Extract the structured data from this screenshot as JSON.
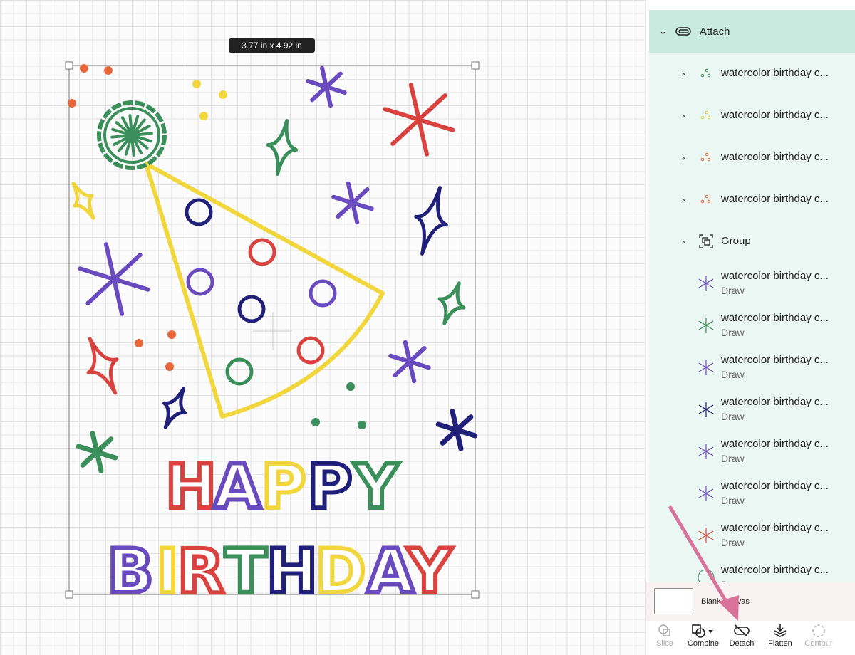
{
  "canvas": {
    "dimensions": "3.77  in x 4.92  in",
    "happy": [
      "H",
      "A",
      "P",
      "P",
      "Y"
    ],
    "birthday": [
      "B",
      "I",
      "R",
      "T",
      "H",
      "D",
      "A",
      "Y"
    ],
    "colors": {
      "red": "#d9423e",
      "purple": "#6a4bbf",
      "yellow": "#f2d73c",
      "navy": "#20207a",
      "green": "#3a8f5a",
      "orange": "#e8663a"
    }
  },
  "layers": {
    "attach_label": "Attach",
    "groups": [
      {
        "label": "watercolor birthday c...",
        "icon": "dots-icon",
        "color": "#3a8f5a"
      },
      {
        "label": "watercolor birthday c...",
        "icon": "dots-icon",
        "color": "#e0d24a"
      },
      {
        "label": "watercolor birthday c...",
        "icon": "dots-icon",
        "color": "#e8663a"
      },
      {
        "label": "watercolor birthday c...",
        "icon": "dots-icon",
        "color": "#e8663a"
      },
      {
        "label": "Group",
        "icon": "group-icon",
        "color": "#333"
      }
    ],
    "draws": [
      {
        "label": "watercolor birthday c...",
        "sub": "Draw",
        "icon": "star-icon",
        "color": "#6a4bbf"
      },
      {
        "label": "watercolor birthday c...",
        "sub": "Draw",
        "icon": "star-icon",
        "color": "#3a8f5a"
      },
      {
        "label": "watercolor birthday c...",
        "sub": "Draw",
        "icon": "star-icon",
        "color": "#6a4bbf"
      },
      {
        "label": "watercolor birthday c...",
        "sub": "Draw",
        "icon": "star-icon",
        "color": "#20207a"
      },
      {
        "label": "watercolor birthday c...",
        "sub": "Draw",
        "icon": "star-icon",
        "color": "#6a4bbf"
      },
      {
        "label": "watercolor birthday c...",
        "sub": "Draw",
        "icon": "star-icon",
        "color": "#6a4bbf"
      },
      {
        "label": "watercolor birthday c...",
        "sub": "Draw",
        "icon": "star-icon",
        "color": "#d9423e"
      },
      {
        "label": "watercolor birthday c...",
        "sub": "Draw",
        "icon": "circle-icon",
        "color": "#3a8f5a"
      }
    ],
    "blank_canvas": "Blank Canvas"
  },
  "toolbar": {
    "slice": "Slice",
    "combine": "Combine",
    "detach": "Detach",
    "flatten": "Flatten",
    "contour": "Contour"
  }
}
